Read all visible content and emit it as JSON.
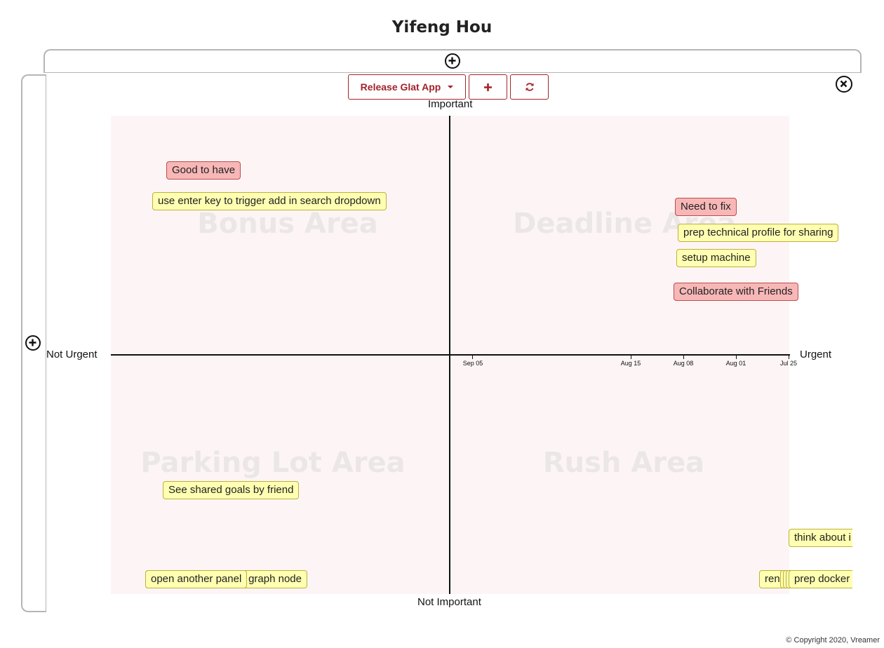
{
  "header": {
    "title": "Yifeng Hou"
  },
  "toolbar": {
    "project_label": "Release Glat App",
    "add_symbol": "✚",
    "refresh_symbol": "↻"
  },
  "axes": {
    "top": "Important",
    "bottom": "Not Important",
    "left": "Not Urgent",
    "right": "Urgent"
  },
  "areas": {
    "top_left": "Bonus Area",
    "top_right": "Deadline Area",
    "bottom_left": "Parking Lot Area",
    "bottom_right": "Rush Area"
  },
  "ticks": [
    "Sep 05",
    "Aug 15",
    "Aug 08",
    "Aug 01",
    "Jul 25"
  ],
  "cards": {
    "good_to_have": "Good to have",
    "enter_key": "use enter key to trigger add in search dropdown",
    "need_to_fix": "Need to fix",
    "prep_profile": "prep technical profile for sharing",
    "setup_machine": "setup machine",
    "collaborate": "Collaborate with Friends",
    "shared_goals": "See shared goals by friend",
    "graph_node": "graph node",
    "another_panel": "open another panel",
    "think_about": "think about i",
    "ren": "ren",
    "prep_docker": "prep docker"
  },
  "footer": {
    "copyright": "© Copyright 2020, Vreamer"
  },
  "icons": {
    "expand_top": "plus-circle-icon",
    "expand_left": "plus-circle-icon",
    "close": "times-circle-icon",
    "dropdown": "caret-down-icon",
    "add": "plus-icon",
    "refresh": "refresh-icon"
  },
  "colors": {
    "accent": "#a3222b",
    "card_yellow": "#ffffb2",
    "card_red": "#f8b7b7",
    "chart_background": "#fdf5f5"
  }
}
